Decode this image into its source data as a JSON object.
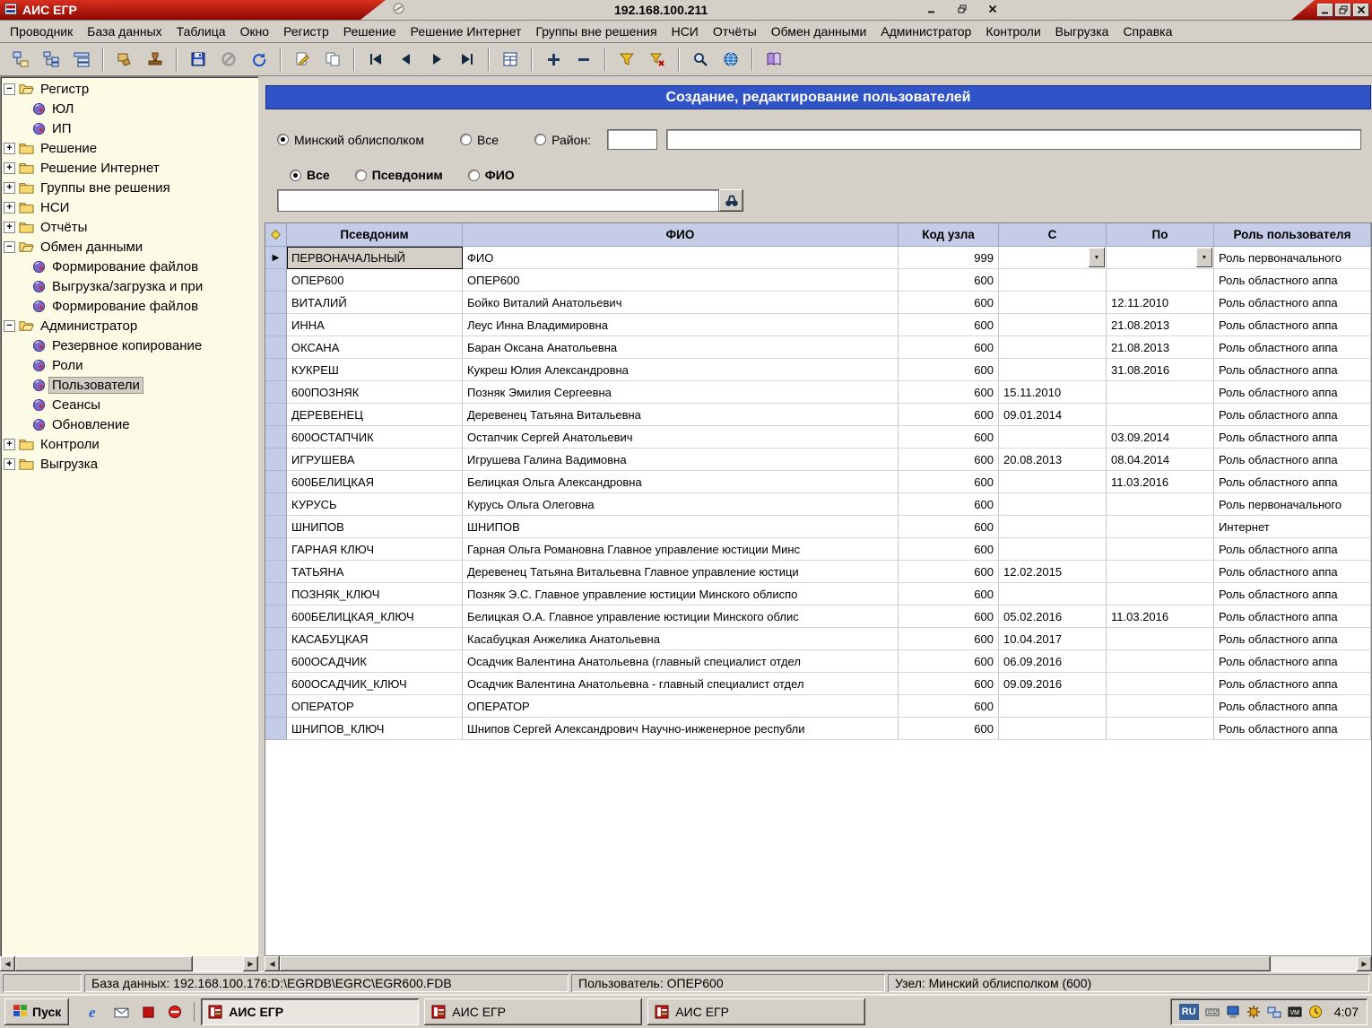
{
  "window": {
    "app_title": "АИС ЕГР",
    "child_title": "192.168.100.211"
  },
  "menu": {
    "items": [
      "Проводник",
      "База данных",
      "Таблица",
      "Окно",
      "Регистр",
      "Решение",
      "Решение Интернет",
      "Группы вне решения",
      "НСИ",
      "Отчёты",
      "Обмен данными",
      "Администратор",
      "Контроли",
      "Выгрузка",
      "Справка"
    ]
  },
  "toolbar": {
    "groups": [
      [
        "view-tree-1",
        "view-tree-2",
        "view-tree-3"
      ],
      [
        "copy-structure",
        "stamp"
      ],
      [
        "save",
        "cancel",
        "refresh"
      ],
      [
        "edit-record",
        "copy-record"
      ],
      [
        "nav-first",
        "nav-prev",
        "nav-next",
        "nav-last"
      ],
      [
        "form-view"
      ],
      [
        "add-record",
        "delete-record"
      ],
      [
        "filter",
        "filter-clear"
      ],
      [
        "search",
        "globe"
      ],
      [
        "help-book"
      ]
    ]
  },
  "sidebar": {
    "items": [
      {
        "label": "Регистр",
        "depth": 0,
        "icon": "folder-open",
        "expand": "minus"
      },
      {
        "label": "ЮЛ",
        "depth": 1,
        "icon": "disc"
      },
      {
        "label": "ИП",
        "depth": 1,
        "icon": "disc"
      },
      {
        "label": "Решение",
        "depth": 0,
        "icon": "folder",
        "expand": "plus"
      },
      {
        "label": "Решение Интернет",
        "depth": 0,
        "icon": "folder",
        "expand": "plus"
      },
      {
        "label": "Группы вне решения",
        "depth": 0,
        "icon": "folder",
        "expand": "plus"
      },
      {
        "label": "НСИ",
        "depth": 0,
        "icon": "folder",
        "expand": "plus"
      },
      {
        "label": "Отчёты",
        "depth": 0,
        "icon": "folder",
        "expand": "plus"
      },
      {
        "label": "Обмен данными",
        "depth": 0,
        "icon": "folder-open",
        "expand": "minus"
      },
      {
        "label": "Формирование файлов",
        "depth": 1,
        "icon": "disc"
      },
      {
        "label": "Выгрузка/загрузка и при",
        "depth": 1,
        "icon": "disc"
      },
      {
        "label": "Формирование файлов",
        "depth": 1,
        "icon": "disc"
      },
      {
        "label": "Администратор",
        "depth": 0,
        "icon": "folder-open",
        "expand": "minus"
      },
      {
        "label": "Резервное копирование",
        "depth": 1,
        "icon": "disc"
      },
      {
        "label": "Роли",
        "depth": 1,
        "icon": "disc"
      },
      {
        "label": "Пользователи",
        "depth": 1,
        "icon": "disc",
        "selected": true
      },
      {
        "label": "Сеансы",
        "depth": 1,
        "icon": "disc"
      },
      {
        "label": "Обновление",
        "depth": 1,
        "icon": "disc"
      },
      {
        "label": "Контроли",
        "depth": 0,
        "icon": "folder",
        "expand": "plus"
      },
      {
        "label": "Выгрузка",
        "depth": 0,
        "icon": "folder",
        "expand": "plus"
      }
    ]
  },
  "content": {
    "title": "Создание, редактирование пользователей",
    "scope_filter": {
      "options": [
        {
          "label": "Минский облисполком",
          "selected": true
        },
        {
          "label": "Все",
          "selected": false
        },
        {
          "label": "Район:",
          "selected": false
        }
      ],
      "district_value": "",
      "name_value": ""
    },
    "search_filter": {
      "options": [
        {
          "label": "Все",
          "selected": true
        },
        {
          "label": "Псевдоним",
          "selected": false
        },
        {
          "label": "ФИО",
          "selected": false
        }
      ],
      "query": ""
    },
    "table": {
      "headers": [
        "Псевдоним",
        "ФИО",
        "Код узла",
        "С",
        "По",
        "Роль пользователя"
      ],
      "active_row": 0,
      "rows": [
        [
          "ПЕРВОНАЧАЛЬНЫЙ",
          "ФИО",
          "999",
          "",
          "",
          "Роль первоначального"
        ],
        [
          "ОПЕР600",
          "ОПЕР600",
          "600",
          "",
          "",
          "Роль областного аппа"
        ],
        [
          "ВИТАЛИЙ",
          "Бойко Виталий Анатольевич",
          "600",
          "",
          "12.11.2010",
          "Роль областного аппа"
        ],
        [
          "ИННА",
          "Леус Инна Владимировна",
          "600",
          "",
          "21.08.2013",
          "Роль областного аппа"
        ],
        [
          "ОКСАНА",
          "Баран Оксана Анатольевна",
          "600",
          "",
          "21.08.2013",
          "Роль областного аппа"
        ],
        [
          "КУКРЕШ",
          "Кукреш Юлия Александровна",
          "600",
          "",
          "31.08.2016",
          "Роль областного аппа"
        ],
        [
          "600ПОЗНЯК",
          "Позняк Эмилия Сергеевна",
          "600",
          "15.11.2010",
          "",
          "Роль областного аппа"
        ],
        [
          "ДЕРЕВЕНЕЦ",
          "Деревенец Татьяна Витальевна",
          "600",
          "09.01.2014",
          "",
          "Роль областного аппа"
        ],
        [
          "600ОСТАПЧИК",
          "Остапчик Сергей Анатольевич",
          "600",
          "",
          "03.09.2014",
          "Роль областного аппа"
        ],
        [
          "ИГРУШЕВА",
          "Игрушева Галина Вадимовна",
          "600",
          "20.08.2013",
          "08.04.2014",
          "Роль областного аппа"
        ],
        [
          "600БЕЛИЦКАЯ",
          "Белицкая Ольга Александровна",
          "600",
          "",
          "11.03.2016",
          "Роль областного аппа"
        ],
        [
          "КУРУСЬ",
          "Курусь Ольга Олеговна",
          "600",
          "",
          "",
          "Роль первоначального"
        ],
        [
          "ШНИПОВ",
          "ШНИПОВ",
          "600",
          "",
          "",
          "Интернет"
        ],
        [
          "ГАРНАЯ КЛЮЧ",
          "Гарная Ольга Романовна Главное управление юстиции Минс",
          "600",
          "",
          "",
          "Роль областного аппа"
        ],
        [
          "ТАТЬЯНА",
          "Деревенец Татьяна Витальевна Главное управление юстици",
          "600",
          "12.02.2015",
          "",
          "Роль областного аппа"
        ],
        [
          "ПОЗНЯК_КЛЮЧ",
          "Позняк Э.С. Главное управление юстиции Минского облиспо",
          "600",
          "",
          "",
          "Роль областного аппа"
        ],
        [
          "600БЕЛИЦКАЯ_КЛЮЧ",
          "Белицкая О.А. Главное управление юстиции Минского облис",
          "600",
          "05.02.2016",
          "11.03.2016",
          "Роль областного аппа"
        ],
        [
          "КАСАБУЦКАЯ",
          "Касабуцкая Анжелика Анатольевна",
          "600",
          "10.04.2017",
          "",
          "Роль областного аппа"
        ],
        [
          "600ОСАДЧИК",
          "Осадчик Валентина Анатольевна (главный специалист отдел",
          "600",
          "06.09.2016",
          "",
          "Роль областного аппа"
        ],
        [
          "600ОСАДЧИК_КЛЮЧ",
          "Осадчик Валентина Анатольевна - главный специалист отдел",
          "600",
          "09.09.2016",
          "",
          "Роль областного аппа"
        ],
        [
          "ОПЕРАТОР",
          "ОПЕРАТОР",
          "600",
          "",
          "",
          "Роль областного аппа"
        ],
        [
          "ШНИПОВ_КЛЮЧ",
          "Шнипов Сергей Александрович Научно-инженерное республи",
          "600",
          "",
          "",
          "Роль областного аппа"
        ]
      ]
    }
  },
  "statusbar": {
    "database": "База данных: 192.168.100.176:D:\\EGRDB\\EGRC\\EGR600.FDB",
    "user": "Пользователь: ОПЕР600",
    "node": "Узел: Минский облисполком (600)"
  },
  "taskbar": {
    "start_label": "Пуск",
    "quick_launch": [
      "internet-explorer",
      "mail",
      "stop",
      "block"
    ],
    "tasks": [
      {
        "label": "АИС ЕГР",
        "active": true
      },
      {
        "label": "АИС ЕГР",
        "active": false
      },
      {
        "label": "АИС ЕГР",
        "active": false
      }
    ],
    "tray": {
      "language": "RU",
      "icons": [
        "keyboard",
        "display",
        "gear",
        "network",
        "vm",
        "clock"
      ],
      "time": "4:07"
    }
  },
  "colors": {
    "title_red": "#a81000",
    "content_blue": "#3054c8",
    "grid_header": "#c4cce8",
    "tree_bg": "#fbfbe6"
  }
}
